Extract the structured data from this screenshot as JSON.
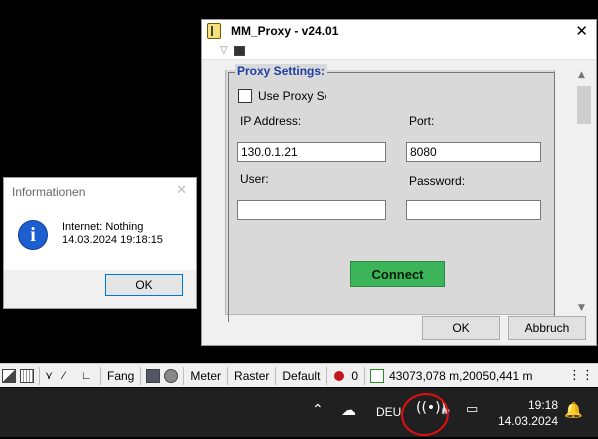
{
  "proxy_window": {
    "title": "MM_Proxy - v24.01",
    "close_glyph": "✕",
    "settings": {
      "legend": "Proxy Settings:",
      "use_proxy_label": "Use Proxy Se",
      "use_proxy_checked": false,
      "ip_label": "IP Address:",
      "ip_value": "130.0.1.21",
      "port_label": "Port:",
      "port_value": "8080",
      "user_label": "User:",
      "user_value": "",
      "password_label": "Password:",
      "password_value": "",
      "connect_label": "Connect"
    },
    "ok_label": "OK",
    "cancel_label": "Abbruch"
  },
  "info_dialog": {
    "title": "Informationen",
    "close_glyph": "✕",
    "message_line1": "Internet: Nothing",
    "message_line2": "14.03.2024 19:18:15",
    "ok_label": "OK"
  },
  "statusbar": {
    "fang": "Fang",
    "meter": "Meter",
    "raster": "Raster",
    "default": "Default",
    "count": "0",
    "coordinates": "43073,078 m,20050,441 m"
  },
  "taskbar": {
    "language": "DEU",
    "time": "19:18",
    "date": "14.03.2024"
  },
  "colors": {
    "connect_button": "#3cb55a",
    "legend_text": "#1f3fa0",
    "annotation_circle": "#e01010"
  }
}
